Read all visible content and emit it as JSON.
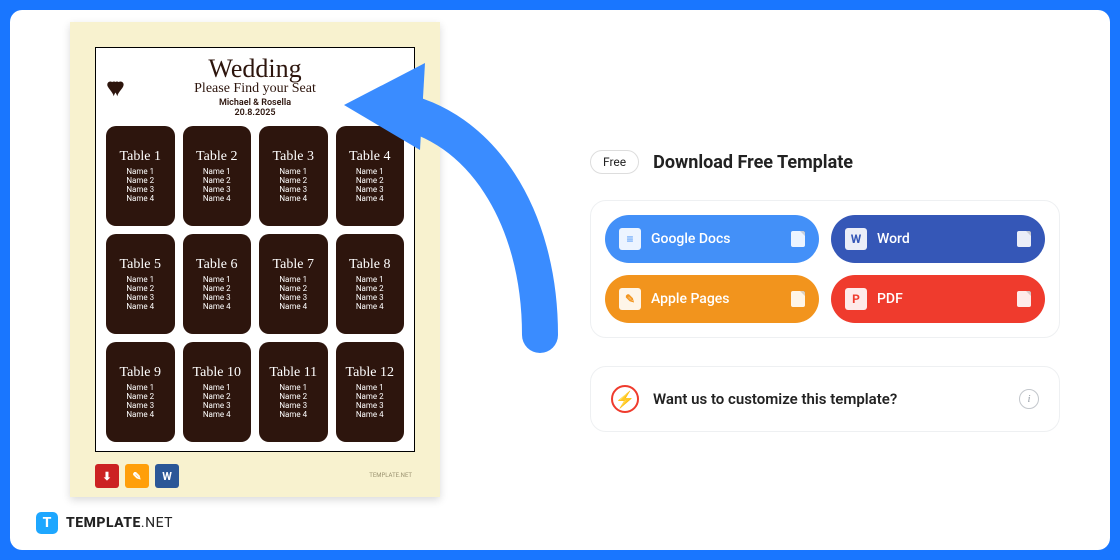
{
  "brand": {
    "icon_letter": "T",
    "name": "TEMPLATE",
    "tld": ".NET"
  },
  "preview": {
    "title": "Wedding",
    "subtitle": "Please Find your Seat",
    "names": "Michael & Rosella",
    "date": "20.8.2025",
    "tables": [
      {
        "title": "Table 1",
        "guests": [
          "Name 1",
          "Name 2",
          "Name 3",
          "Name 4"
        ]
      },
      {
        "title": "Table 2",
        "guests": [
          "Name 1",
          "Name 2",
          "Name 3",
          "Name 4"
        ]
      },
      {
        "title": "Table 3",
        "guests": [
          "Name 1",
          "Name 2",
          "Name 3",
          "Name 4"
        ]
      },
      {
        "title": "Table 4",
        "guests": [
          "Name 1",
          "Name 2",
          "Name 3",
          "Name 4"
        ]
      },
      {
        "title": "Table 5",
        "guests": [
          "Name 1",
          "Name 2",
          "Name 3",
          "Name 4"
        ]
      },
      {
        "title": "Table 6",
        "guests": [
          "Name 1",
          "Name 2",
          "Name 3",
          "Name 4"
        ]
      },
      {
        "title": "Table 7",
        "guests": [
          "Name 1",
          "Name 2",
          "Name 3",
          "Name 4"
        ]
      },
      {
        "title": "Table 8",
        "guests": [
          "Name 1",
          "Name 2",
          "Name 3",
          "Name 4"
        ]
      },
      {
        "title": "Table 9",
        "guests": [
          "Name 1",
          "Name 2",
          "Name 3",
          "Name 4"
        ]
      },
      {
        "title": "Table 10",
        "guests": [
          "Name 1",
          "Name 2",
          "Name 3",
          "Name 4"
        ]
      },
      {
        "title": "Table 11",
        "guests": [
          "Name 1",
          "Name 2",
          "Name 3",
          "Name 4"
        ]
      },
      {
        "title": "Table 12",
        "guests": [
          "Name 1",
          "Name 2",
          "Name 3",
          "Name 4"
        ]
      }
    ],
    "format_badges": [
      "PDF",
      "Pages",
      "Word"
    ],
    "watermark": "TEMPLATE.NET"
  },
  "right": {
    "free_label": "Free",
    "title": "Download Free Template",
    "buttons": [
      {
        "key": "gdocs",
        "label": "Google Docs",
        "cls": "dl-gdocs",
        "icon": "document-icon"
      },
      {
        "key": "word",
        "label": "Word",
        "cls": "dl-word",
        "icon": "word-icon"
      },
      {
        "key": "pages",
        "label": "Apple Pages",
        "cls": "dl-pages",
        "icon": "pages-icon"
      },
      {
        "key": "pdf",
        "label": "PDF",
        "cls": "dl-pdf",
        "icon": "pdf-icon"
      }
    ],
    "icon_glyphs": {
      "gdocs": "≡",
      "word": "W",
      "pages": "✎",
      "pdf": "P"
    },
    "customize": {
      "text": "Want us to customize this template?"
    }
  },
  "colors": {
    "primary_blue": "#1976ff"
  }
}
